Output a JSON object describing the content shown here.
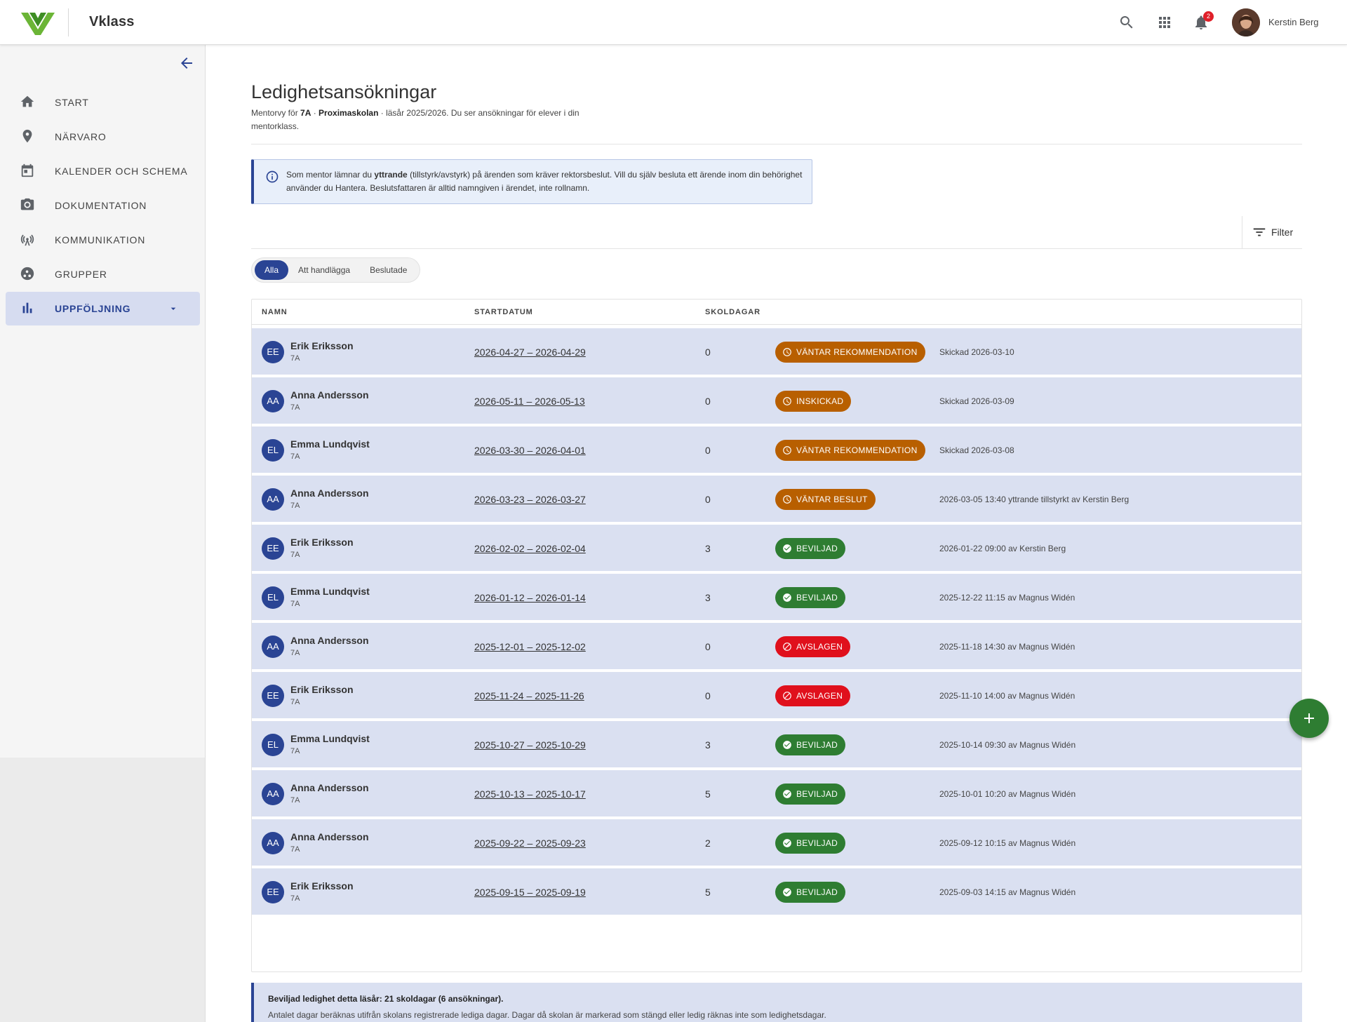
{
  "header": {
    "brand": "Vklass",
    "notifications_count": "2",
    "user_name": "Kerstin Berg",
    "icons": [
      "search-icon",
      "apps-grid-icon",
      "bell-icon"
    ]
  },
  "sidebar": {
    "items": [
      {
        "label": "START",
        "icon": "home-icon"
      },
      {
        "label": "NÄRVARO",
        "icon": "location-pin-icon"
      },
      {
        "label": "KALENDER OCH SCHEMA",
        "icon": "calendar-icon"
      },
      {
        "label": "DOKUMENTATION",
        "icon": "camera-icon"
      },
      {
        "label": "KOMMUNIKATION",
        "icon": "broadcast-icon"
      },
      {
        "label": "GRUPPER",
        "icon": "groups-icon"
      },
      {
        "label": "UPPFÖLJNING",
        "icon": "bar-chart-icon",
        "active": true
      }
    ]
  },
  "page": {
    "title": "Ledighetsansökningar",
    "subtitle_prefix": "Mentorvy för ",
    "subtitle_class": "7A",
    "subtitle_sep": " · ",
    "subtitle_school": "Proximaskolan",
    "subtitle_suffix": " · läsår 2025/2026. Du ser ansökningar för elever i din mentorklass."
  },
  "info": {
    "text_a": "Som mentor lämnar du ",
    "text_bold": "yttrande",
    "text_b": " (tillstyrk/avstyrk) på ärenden som kräver rektorsbeslut. Vill du själv besluta ett ärende inom din behörighet använder du Hantera. Beslutsfattaren är alltid namngiven i ärendet, inte rollnamn."
  },
  "filter": {
    "label": "Filter"
  },
  "tabs": [
    {
      "label": "Alla",
      "active": true
    },
    {
      "label": "Att handlägga",
      "active": false
    },
    {
      "label": "Beslutade",
      "active": false
    }
  ],
  "table": {
    "headers": {
      "name": "NAMN",
      "start": "STARTDATUM",
      "days": "SKOLDAGAR"
    },
    "rows": [
      {
        "initials": "EE",
        "name": "Erik Eriksson",
        "class": "7A",
        "dates": "2026-04-27 – 2026-04-29",
        "days": "0",
        "status": "VÄNTAR REKOMMENDATION",
        "kind": "pending",
        "note": "Skickad 2026-03-10"
      },
      {
        "initials": "AA",
        "name": "Anna Andersson",
        "class": "7A",
        "dates": "2026-05-11 – 2026-05-13",
        "days": "0",
        "status": "INSKICKAD",
        "kind": "pending",
        "note": "Skickad 2026-03-09"
      },
      {
        "initials": "EL",
        "name": "Emma Lundqvist",
        "class": "7A",
        "dates": "2026-03-30 – 2026-04-01",
        "days": "0",
        "status": "VÄNTAR REKOMMENDATION",
        "kind": "pending",
        "note": "Skickad 2026-03-08"
      },
      {
        "initials": "AA",
        "name": "Anna Andersson",
        "class": "7A",
        "dates": "2026-03-23 – 2026-03-27",
        "days": "0",
        "status": "VÄNTAR BESLUT",
        "kind": "pending",
        "note": "2026-03-05 13:40 yttrande tillstyrkt av Kerstin Berg"
      },
      {
        "initials": "EE",
        "name": "Erik Eriksson",
        "class": "7A",
        "dates": "2026-02-02 – 2026-02-04",
        "days": "3",
        "status": "BEVILJAD",
        "kind": "granted",
        "note": "2026-01-22 09:00 av Kerstin Berg"
      },
      {
        "initials": "EL",
        "name": "Emma Lundqvist",
        "class": "7A",
        "dates": "2026-01-12 – 2026-01-14",
        "days": "3",
        "status": "BEVILJAD",
        "kind": "granted",
        "note": "2025-12-22 11:15 av Magnus Widén"
      },
      {
        "initials": "AA",
        "name": "Anna Andersson",
        "class": "7A",
        "dates": "2025-12-01 – 2025-12-02",
        "days": "0",
        "status": "AVSLAGEN",
        "kind": "denied",
        "note": "2025-11-18 14:30 av Magnus Widén"
      },
      {
        "initials": "EE",
        "name": "Erik Eriksson",
        "class": "7A",
        "dates": "2025-11-24 – 2025-11-26",
        "days": "0",
        "status": "AVSLAGEN",
        "kind": "denied",
        "note": "2025-11-10 14:00 av Magnus Widén"
      },
      {
        "initials": "EL",
        "name": "Emma Lundqvist",
        "class": "7A",
        "dates": "2025-10-27 – 2025-10-29",
        "days": "3",
        "status": "BEVILJAD",
        "kind": "granted",
        "note": "2025-10-14 09:30 av Magnus Widén"
      },
      {
        "initials": "AA",
        "name": "Anna Andersson",
        "class": "7A",
        "dates": "2025-10-13 – 2025-10-17",
        "days": "5",
        "status": "BEVILJAD",
        "kind": "granted",
        "note": "2025-10-01 10:20 av Magnus Widén"
      },
      {
        "initials": "AA",
        "name": "Anna Andersson",
        "class": "7A",
        "dates": "2025-09-22 – 2025-09-23",
        "days": "2",
        "status": "BEVILJAD",
        "kind": "granted",
        "note": "2025-09-12 10:15 av Magnus Widén"
      },
      {
        "initials": "EE",
        "name": "Erik Eriksson",
        "class": "7A",
        "dates": "2025-09-15 – 2025-09-19",
        "days": "5",
        "status": "BEVILJAD",
        "kind": "granted",
        "note": "2025-09-03 14:15 av Magnus Widén"
      }
    ]
  },
  "summary": {
    "title": "Beviljad ledighet detta läsår: 21 skoldagar (6 ansökningar).",
    "text": "Antalet dagar beräknas utifrån skolans registrerade lediga dagar. Dagar då skolan är markerad som stängd eller ledig räknas inte som ledighetsdagar."
  },
  "colors": {
    "primary": "#2a4494",
    "row_bg": "#dae0f1",
    "pending": "#b85f00",
    "granted": "#2e7d32",
    "denied": "#e0101c",
    "brand_green": "#6bb536"
  }
}
